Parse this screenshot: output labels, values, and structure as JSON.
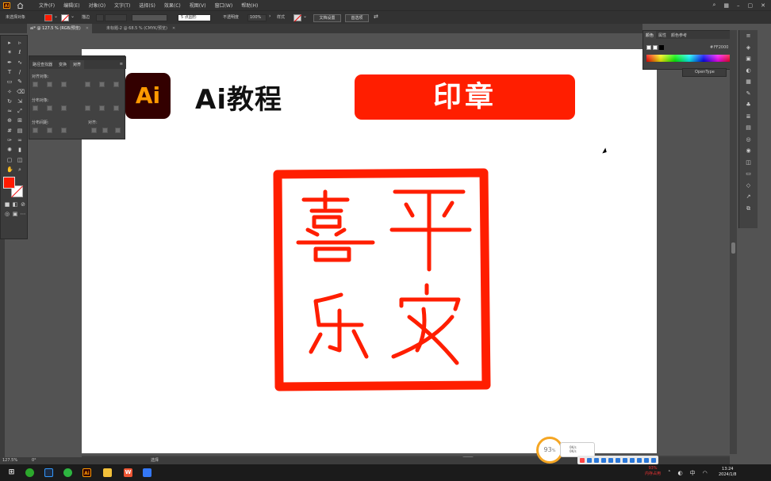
{
  "app": {
    "logo_text": "Ai"
  },
  "menu": {
    "items": [
      "文件(F)",
      "编辑(E)",
      "对象(O)",
      "文字(T)",
      "选择(S)",
      "效果(C)",
      "视图(V)",
      "窗口(W)",
      "帮助(H)"
    ]
  },
  "control_bar": {
    "selection_label": "未选择对象",
    "stroke_label": "描边",
    "style_label": "5 点圆形",
    "opacity_label": "不透明度",
    "opacity_value": "100%",
    "style2_label": "样式",
    "doc_setup_button": "文档设置",
    "prefs_button": "首选项"
  },
  "tabs": [
    {
      "label": "ai* @ 127.5 % (RGB/预览)",
      "active": true
    },
    {
      "label": "未标题-2 @ 68.5 % (CMYK/预览)",
      "active": false
    }
  ],
  "align_panel": {
    "tabs": [
      "路径查找器",
      "变换",
      "对齐"
    ],
    "active_tab": "对齐",
    "section_align_objects": "对齐对象:",
    "section_distribute_objects": "分布对象:",
    "section_distribute_spacing": "分布间距:",
    "section_align_to": "对齐:"
  },
  "artboard": {
    "ai_logo": "Ai",
    "title": "Ai教程",
    "banner": "印章",
    "seal_colour": "#ff1e00"
  },
  "color_panel": {
    "tabs": [
      "颜色",
      "属性",
      "颜色参考"
    ],
    "active_tab": "颜色",
    "hex_value": "FF2000",
    "opentype_label": "OpenType"
  },
  "status": {
    "zoom": "127.5%",
    "rotation": "0°",
    "tool_name": "选择"
  },
  "perf_widget": {
    "value": "93",
    "unit": "%",
    "net_up": "0K/s",
    "net_down": "0K/s"
  },
  "taskbar": {
    "mem_percent": "93%",
    "mem_label": "内存占用",
    "time": "13:24",
    "date": "2024/1/8"
  },
  "colors": {
    "accent_red": "#ff1e00",
    "ai_dark": "#330000",
    "ai_orange": "#ff9a00",
    "ui_dark": "#323232"
  }
}
